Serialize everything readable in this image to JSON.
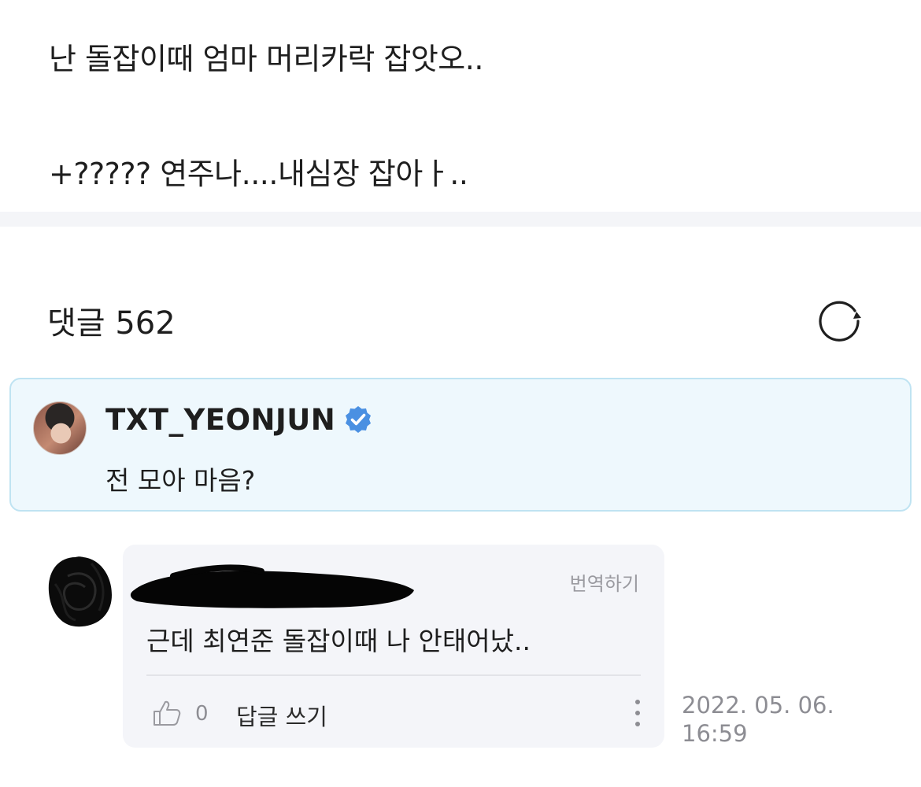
{
  "post": {
    "line1": "난 돌잡이때 엄마 머리카락 잡앗오..",
    "line2": "+????? 연주나....내심장 잡아ㅏ.."
  },
  "comments": {
    "title": "댓글 562",
    "refresh_icon": "refresh-icon"
  },
  "artist_comment": {
    "name": "TXT_YEONJUN",
    "verified_icon": "verified-badge-icon",
    "verified_color": "#4a90e2",
    "text": "전 모아 마음?"
  },
  "reply": {
    "translate_label": "번역하기",
    "text": "근데 최연준 돌잡이때 나 안태어났..",
    "like_count": "0",
    "reply_label": "답글 쓰기",
    "timestamp_date": "2022. 05. 06.",
    "timestamp_time": "16:59"
  },
  "colors": {
    "artist_bg": "#eef8fd",
    "artist_border": "#bfe3f2",
    "reply_bg": "#f4f5f9",
    "separator": "#f4f5f8"
  }
}
